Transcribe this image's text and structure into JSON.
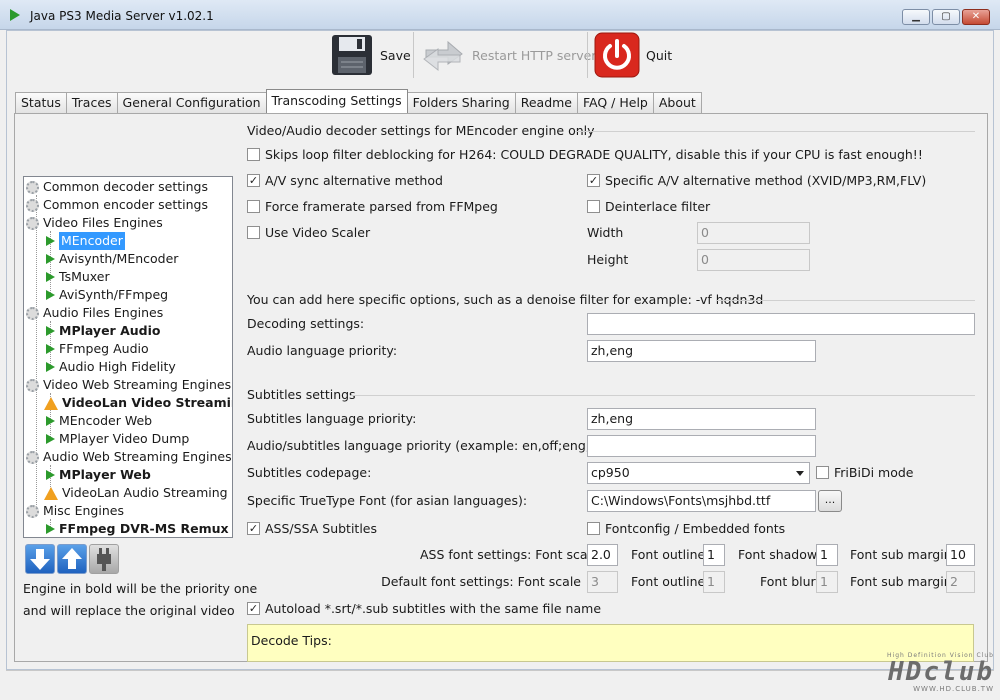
{
  "window": {
    "title": "Java PS3 Media Server v1.02.1",
    "minimize_glyph": "▁",
    "maximize_glyph": "▢",
    "close_glyph": "✕"
  },
  "toolbar": {
    "save_label": "Save",
    "restart_label": "Restart HTTP server",
    "quit_label": "Quit"
  },
  "tabs": [
    {
      "label": "Status"
    },
    {
      "label": "Traces"
    },
    {
      "label": "General Configuration"
    },
    {
      "label": "Transcoding Settings",
      "active": true
    },
    {
      "label": "Folders Sharing"
    },
    {
      "label": "Readme"
    },
    {
      "label": "FAQ / Help"
    },
    {
      "label": "About"
    }
  ],
  "tree": {
    "items": [
      {
        "label": "Common decoder settings",
        "icon": "gear-icon"
      },
      {
        "label": "Common encoder settings",
        "icon": "gear-icon"
      },
      {
        "label": "Video Files Engines",
        "icon": "gear-icon"
      },
      {
        "label": "MEncoder",
        "icon": "play-icon",
        "selected": true
      },
      {
        "label": "Avisynth/MEncoder",
        "icon": "play-icon"
      },
      {
        "label": "TsMuxer",
        "icon": "play-icon"
      },
      {
        "label": "AviSynth/FFmpeg",
        "icon": "play-icon"
      },
      {
        "label": "Audio Files Engines",
        "icon": "gear-icon"
      },
      {
        "label": "MPlayer Audio",
        "icon": "play-icon",
        "bold": true
      },
      {
        "label": "FFmpeg Audio",
        "icon": "play-icon"
      },
      {
        "label": "Audio High Fidelity",
        "icon": "play-icon"
      },
      {
        "label": "Video Web Streaming Engines",
        "icon": "gear-icon"
      },
      {
        "label": "VideoLan Video Streaming",
        "icon": "warning-icon",
        "bold": true
      },
      {
        "label": "MEncoder Web",
        "icon": "play-icon"
      },
      {
        "label": "MPlayer Video Dump",
        "icon": "play-icon"
      },
      {
        "label": "Audio Web Streaming Engines",
        "icon": "gear-icon"
      },
      {
        "label": "MPlayer Web",
        "icon": "play-icon",
        "bold": true
      },
      {
        "label": "VideoLan Audio Streaming",
        "icon": "warning-icon"
      },
      {
        "label": "Misc Engines",
        "icon": "gear-icon"
      },
      {
        "label": "FFmpeg DVR-MS Remux",
        "icon": "play-icon",
        "bold": true
      }
    ]
  },
  "engine_note": {
    "line1": "Engine in bold will be the priority one",
    "line2": "and will replace the original video"
  },
  "decoder": {
    "section_title": "Video/Audio decoder settings for MEncoder engine only",
    "skip_loop_filter": "Skips loop filter deblocking for H264: COULD DEGRADE QUALITY, disable this if your CPU is fast enough!!",
    "av_sync": "A/V sync alternative method",
    "specific_av": "Specific A/V alternative method (XVID/MP3,RM,FLV)",
    "force_framerate": "Force framerate parsed from FFMpeg",
    "deinterlace": "Deinterlace filter",
    "use_scaler": "Use Video Scaler",
    "width_label": "Width",
    "width_value": "0",
    "height_label": "Height",
    "height_value": "0",
    "options_hint": "You can add here specific options, such as a denoise filter for example: -vf hqdn3d",
    "decoding_settings_label": "Decoding settings:",
    "decoding_settings_value": "",
    "audio_lang_label": "Audio language priority:",
    "audio_lang_value": "zh,eng"
  },
  "subtitles": {
    "section_title": "Subtitles settings",
    "sub_lang_label": "Subtitles language priority:",
    "sub_lang_value": "zh,eng",
    "audio_sub_label": "Audio/subtitles language priority (example:  en,off;eng,off )",
    "audio_sub_value": "",
    "codepage_label": "Subtitles codepage:",
    "codepage_value": "cp950",
    "fribidi": "FriBiDi mode",
    "font_label": "Specific TrueType Font (for asian languages):",
    "font_value": "C:\\Windows\\Fonts\\msjhbd.ttf",
    "browse_label": "...",
    "ass_ssa": "ASS/SSA Subtitles",
    "fontconfig": "Fontconfig / Embedded fonts",
    "ass_font_scale_label": "ASS font settings: Font scale",
    "ass_font_scale": "2.0",
    "ass_outline_label": "Font outline",
    "ass_outline": "1",
    "ass_shadow_label": "Font shadow",
    "ass_shadow": "1",
    "ass_margin_label": "Font sub margin",
    "ass_margin": "10",
    "def_font_scale_label": "Default font settings: Font scale",
    "def_font_scale": "3",
    "def_outline_label": "Font outline",
    "def_outline": "1",
    "def_blur_label": "Font blur",
    "def_blur": "1",
    "def_margin_label": "Font sub margin",
    "def_margin": "2",
    "autoload": "Autoload *.srt/*.sub subtitles with the same file name"
  },
  "tips": {
    "label": "Decode Tips:"
  },
  "watermark": {
    "brand": "HDclub",
    "tagline": "High Definition Vision Club",
    "url": "WWW.HD.CLUB.TW"
  },
  "colors": {
    "accent_blue": "#3399ff",
    "quit_red": "#d9281e",
    "tips_yellow": "#ffffc0",
    "play_green": "#2c9a2c",
    "warning_orange": "#f0a020"
  }
}
